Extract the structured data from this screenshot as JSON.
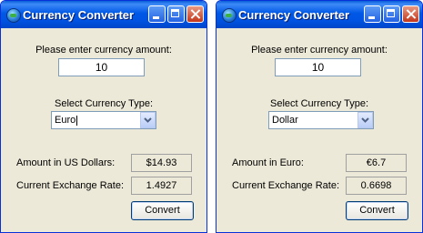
{
  "windows": [
    {
      "title": "Currency Converter",
      "prompt_label": "Please enter currency amount:",
      "amount_value": "10",
      "select_label": "Select Currency Type:",
      "selected_currency": "Euro",
      "result_label": "Amount in US Dollars:",
      "result_value": "$14.93",
      "rate_label": "Current Exchange Rate:",
      "rate_value": "1.4927",
      "convert_label": "Convert"
    },
    {
      "title": "Currency Converter",
      "prompt_label": "Please enter currency amount:",
      "amount_value": "10",
      "select_label": "Select Currency Type:",
      "selected_currency": "Dollar",
      "result_label": "Amount in Euro:",
      "result_value": "€6.7",
      "rate_label": "Current Exchange Rate:",
      "rate_value": "0.6698",
      "convert_label": "Convert"
    }
  ],
  "icons": {
    "app": "globe-icon",
    "minimize": "minimize-icon",
    "maximize": "maximize-icon",
    "close": "close-icon",
    "dropdown": "chevron-down-icon"
  },
  "colors": {
    "titlebar": "#0054e3",
    "window_bg": "#ece9d8",
    "close_button": "#c2351a"
  }
}
